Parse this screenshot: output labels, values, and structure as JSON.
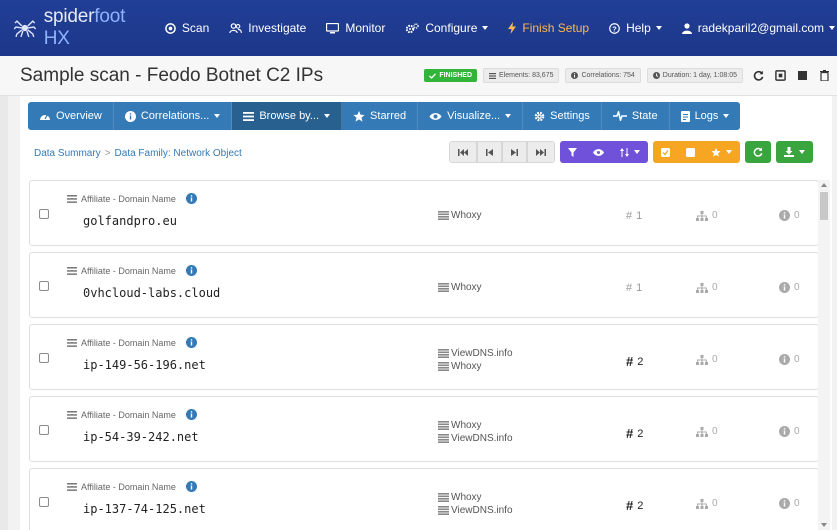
{
  "nav": {
    "brand_a": "spider",
    "brand_b": "foot HX",
    "items": [
      {
        "label": "Scan",
        "icon": "target-icon"
      },
      {
        "label": "Investigate",
        "icon": "people-icon"
      },
      {
        "label": "Monitor",
        "icon": "monitor-icon"
      },
      {
        "label": "Configure",
        "icon": "cogs-icon"
      }
    ],
    "finish_setup": "Finish Setup",
    "help": "Help",
    "user": "radekparil2@gmail.com",
    "colors": {
      "bar": "#1f3a93",
      "finish": "#ffb84d"
    }
  },
  "titlebar": {
    "title": "Sample scan - Feodo Botnet C2 IPs",
    "status": "FINISHED",
    "elements": "Elements: 83,675",
    "correlations": "Correlations: 754",
    "duration": "Duration: 1 day, 1:08:05"
  },
  "tabs": [
    {
      "label": "Overview",
      "icon": "dashboard-icon"
    },
    {
      "label": "Correlations...",
      "icon": "info-circle-icon"
    },
    {
      "label": "Browse by...",
      "icon": "list-icon"
    },
    {
      "label": "Starred",
      "icon": "star-icon"
    },
    {
      "label": "Visualize...",
      "icon": "eye-icon"
    },
    {
      "label": "Settings",
      "icon": "gear-icon"
    },
    {
      "label": "State",
      "icon": "pulse-icon"
    },
    {
      "label": "Logs",
      "icon": "document-icon"
    }
  ],
  "breadcrumb": {
    "root": "Data Summary",
    "sep": ">",
    "current": "Data Family: Network Object"
  },
  "rows": [
    {
      "type": "Affiliate - Domain Name",
      "value": "golfandpro.eu",
      "sources": [
        "Whoxy"
      ],
      "count": "1",
      "children": "0",
      "info": "0"
    },
    {
      "type": "Affiliate - Domain Name",
      "value": "0vhcloud-labs.cloud",
      "sources": [
        "Whoxy"
      ],
      "count": "1",
      "children": "0",
      "info": "0"
    },
    {
      "type": "Affiliate - Domain Name",
      "value": "ip-149-56-196.net",
      "sources": [
        "ViewDNS.info",
        "Whoxy"
      ],
      "count": "2",
      "children": "0",
      "info": "0"
    },
    {
      "type": "Affiliate - Domain Name",
      "value": "ip-54-39-242.net",
      "sources": [
        "Whoxy",
        "ViewDNS.info"
      ],
      "count": "2",
      "children": "0",
      "info": "0"
    },
    {
      "type": "Affiliate - Domain Name",
      "value": "ip-137-74-125.net",
      "sources": [
        "Whoxy",
        "ViewDNS.info"
      ],
      "count": "2",
      "children": "0",
      "info": "0"
    }
  ]
}
